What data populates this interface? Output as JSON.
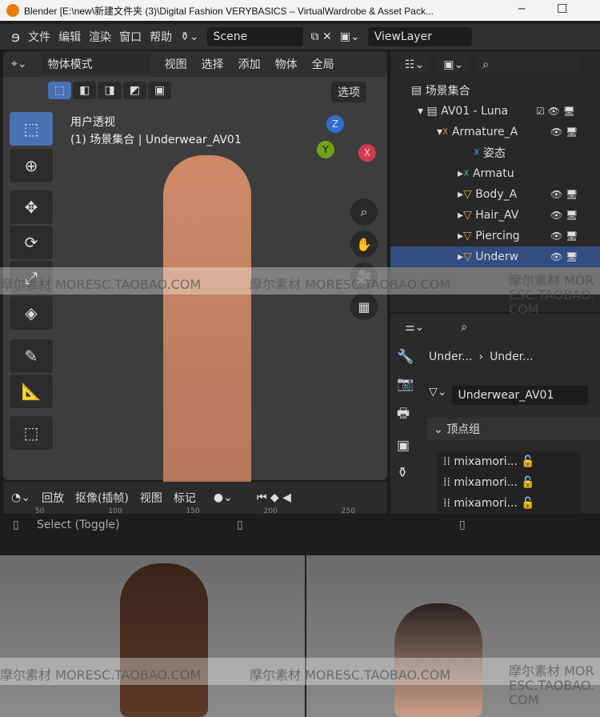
{
  "window": {
    "title": "Blender [E:\\new\\新建文件夹 (3)\\Digital Fashion VERYBASICS – VirtualWardrobe & Asset Pack...",
    "minimize": "–",
    "maximize": "☐"
  },
  "menu": [
    "文件",
    "编辑",
    "渲染",
    "窗口",
    "帮助"
  ],
  "scene": "Scene",
  "view_layer": "ViewLayer",
  "viewport": {
    "mode": "物体模式",
    "menus": [
      "视图",
      "选择",
      "添加",
      "物体"
    ],
    "transform": "全局",
    "options": "选项",
    "view_name": "用户透视",
    "collection_info": "(1) 场景集合 | Underwear_AV01",
    "gizmo": {
      "z": "Z",
      "y": "Y",
      "x": "X"
    }
  },
  "outliner": {
    "root": "场景集合",
    "rows": [
      {
        "label": "AV01 - Luna",
        "depth": 1
      },
      {
        "label": "Armature_A",
        "depth": 2
      },
      {
        "label": "姿态",
        "depth": 3
      },
      {
        "label": "Armatu",
        "depth": 3
      },
      {
        "label": "Body_A",
        "depth": 3
      },
      {
        "label": "Hair_AV",
        "depth": 3
      },
      {
        "label": "Piercing",
        "depth": 3
      },
      {
        "label": "Underw",
        "depth": 3
      }
    ]
  },
  "properties": {
    "breadcrumb": [
      "Under...",
      "Under..."
    ],
    "mesh_name": "Underwear_AV01",
    "panel": "顶点组",
    "vertex_groups": [
      "mixamori...",
      "mixamori...",
      "mixamori..."
    ]
  },
  "timeline": {
    "playback": "回放",
    "keying": "抠像(插帧)",
    "view": "视图",
    "marker": "标记",
    "frames": [
      "50",
      "100",
      "150",
      "200",
      "250"
    ]
  },
  "status": {
    "hint": "Select (Toggle)"
  },
  "watermark": "摩尔素材 MORESC.TAOBAO.COM"
}
